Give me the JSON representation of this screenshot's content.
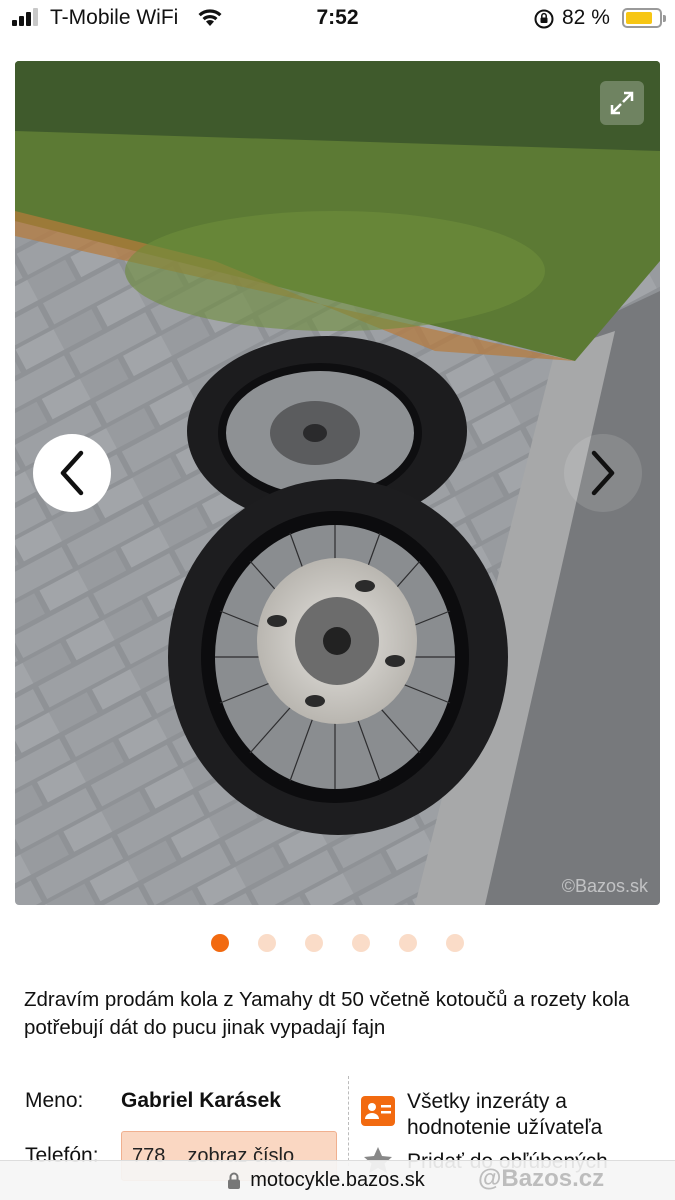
{
  "status_bar": {
    "carrier": "T-Mobile WiFi",
    "time": "7:52",
    "battery_percent": "82 %",
    "battery_level": 0.82,
    "icons": [
      "signal-icon",
      "wifi-icon",
      "orientation-lock-icon",
      "battery-icon"
    ]
  },
  "gallery": {
    "watermark": "©Bazos.sk",
    "total_images": 6,
    "active_index": 0,
    "colors": {
      "active_dot": "#f26a10",
      "inactive_dot": "#fadcc8"
    }
  },
  "listing": {
    "description": "Zdravím prodám kola z Yamahy dt 50 včetně kotoučů a rozety kola potřebují dát do pucu jinak vypadají fajn"
  },
  "seller": {
    "name_label": "Meno:",
    "name": "Gabriel Karásek",
    "phone_label": "Telefón:",
    "phone_prefix": "778",
    "phone_reveal": "zobraz číslo",
    "all_ads_link": "Všetky inzeráty a hodnotenie užívateľa",
    "partial_link": "Pridať do obľúbených"
  },
  "browser": {
    "url": "motocykle.bazos.sk",
    "watermark": "@Bazos.cz"
  }
}
